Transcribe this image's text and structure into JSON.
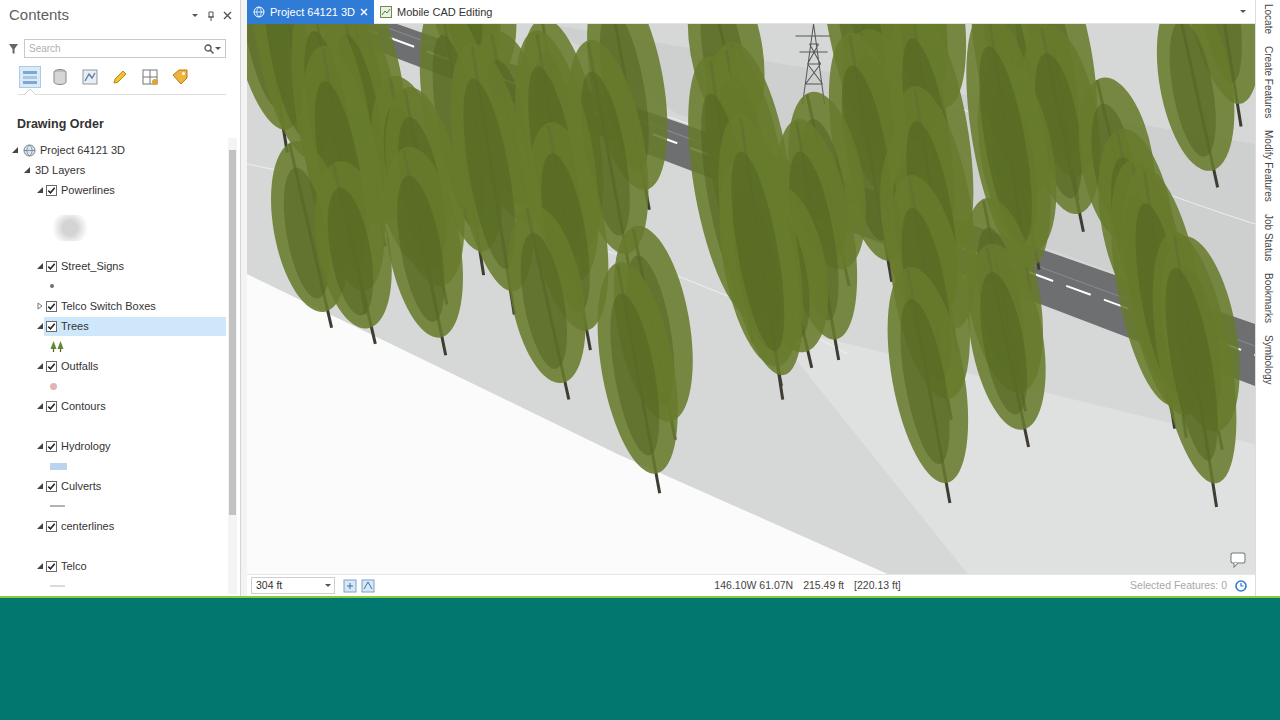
{
  "contents_pane": {
    "title": "Contents",
    "search": {
      "placeholder": "Search"
    },
    "view_buttons": [
      {
        "selected": true
      },
      {
        "selected": false
      },
      {
        "selected": false
      },
      {
        "selected": false
      },
      {
        "selected": false
      },
      {
        "selected": false
      }
    ],
    "section_title": "Drawing Order",
    "project": {
      "label": "Project 64121 3D",
      "expanded": true
    },
    "group": {
      "label": "3D Layers",
      "expanded": true
    },
    "layers": [
      {
        "label": "Powerlines",
        "checked": true,
        "expanded": true,
        "selected": false,
        "kind": "image",
        "color": "#c9c9c9"
      },
      {
        "label": "Street_Signs",
        "checked": true,
        "expanded": true,
        "selected": false,
        "kind": "dot",
        "color": "#6f6f6f"
      },
      {
        "label": "Telco Switch Boxes",
        "checked": true,
        "expanded": false,
        "selected": false,
        "kind": "none",
        "color": "#ffffff"
      },
      {
        "label": "Trees",
        "checked": true,
        "expanded": true,
        "selected": true,
        "kind": "tree",
        "color": "#5c8a2e"
      },
      {
        "label": "Outfalls",
        "checked": true,
        "expanded": true,
        "selected": false,
        "kind": "bigdot",
        "color": "#e3b2b2"
      },
      {
        "label": "Contours",
        "checked": true,
        "expanded": true,
        "selected": false,
        "kind": "blank",
        "color": "#ffffff"
      },
      {
        "label": "Hydrology",
        "checked": true,
        "expanded": true,
        "selected": false,
        "kind": "rect",
        "color": "#bcd3ee"
      },
      {
        "label": "Culverts",
        "checked": true,
        "expanded": true,
        "selected": false,
        "kind": "line",
        "color": "#b3b3b3"
      },
      {
        "label": "centerlines",
        "checked": true,
        "expanded": true,
        "selected": false,
        "kind": "blank",
        "color": "#ffffff"
      },
      {
        "label": "Telco",
        "checked": true,
        "expanded": true,
        "selected": false,
        "kind": "line",
        "color": "#dadada"
      }
    ]
  },
  "map_tabs": [
    {
      "label": "Project 64121 3D",
      "selected": true,
      "closable": true
    },
    {
      "label": "Mobile CAD Editing",
      "selected": false,
      "closable": false
    }
  ],
  "map_status": {
    "scale": "304 ft",
    "coordinates": "146.10W 61.07N",
    "elevation": "215.49 ft",
    "camera_elevation": "[220.13 ft]",
    "selected_features": {
      "label": "Selected Features: 0",
      "disabled": true
    }
  },
  "side_tabs": [
    "Locate",
    "Create Features",
    "Modify Features",
    "Job Status",
    "Bookmarks",
    "Symbology"
  ]
}
